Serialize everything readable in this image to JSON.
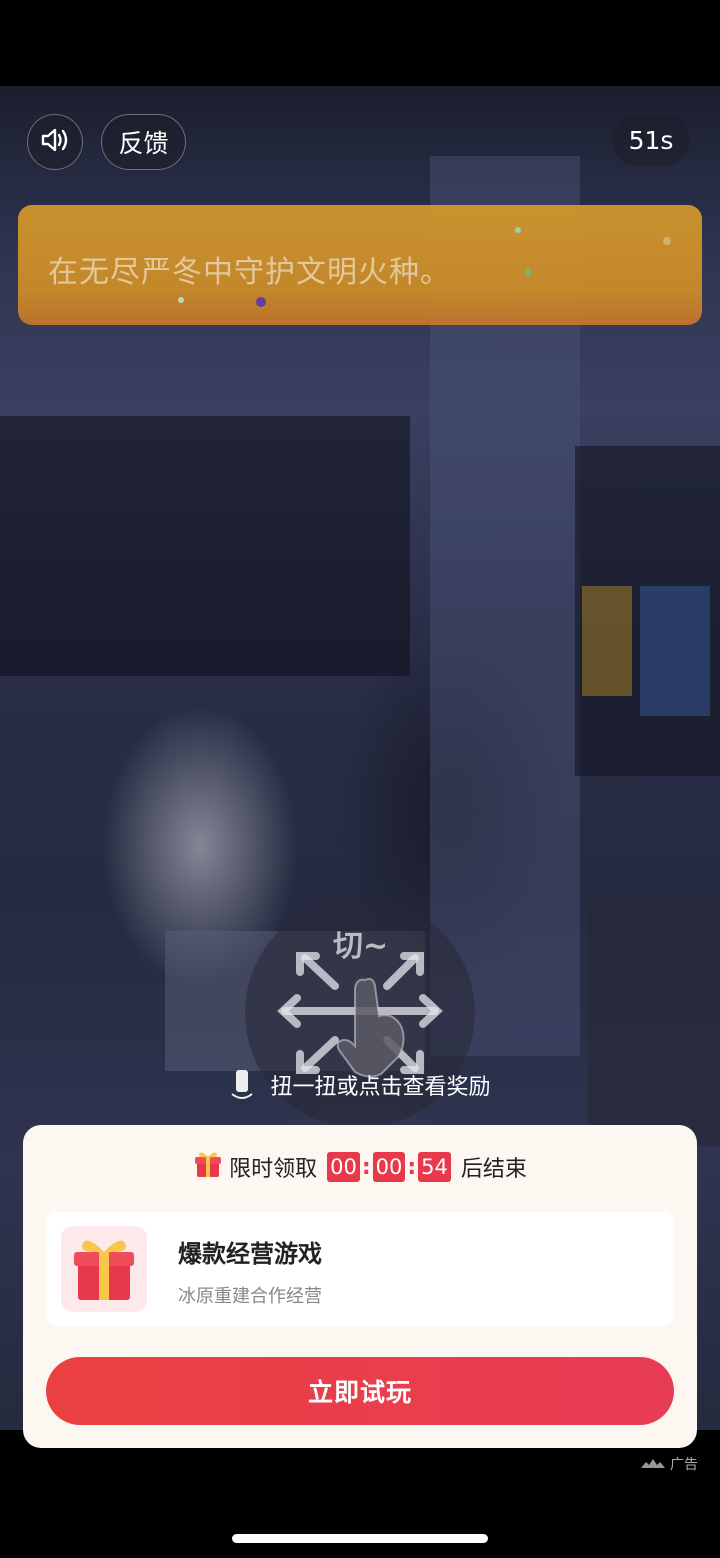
{
  "header": {
    "feedback_label": "反馈",
    "timer_text": "51s"
  },
  "banner": {
    "text": "在无尽严冬中守护文明火种。"
  },
  "gesture": {
    "overlay_text": "切~",
    "hint": "扭一扭或点击查看奖励"
  },
  "card": {
    "countdown_prefix": "限时领取",
    "countdown": {
      "hh": "00",
      "mm": "00",
      "ss": "54"
    },
    "countdown_suffix": "后结束",
    "app_title": "爆款经营游戏",
    "app_subtitle": "冰原重建合作经营",
    "cta_label": "立即试玩"
  },
  "ad_label": "广告",
  "icons": [
    "speaker-icon",
    "gift-icon",
    "phone-shake-icon",
    "hand-swipe-icon",
    "ad-logo-icon"
  ],
  "colors": {
    "accent_red": "#e8394a",
    "banner_orange": "#d79a2c",
    "card_bg": "#fdf7f2"
  }
}
